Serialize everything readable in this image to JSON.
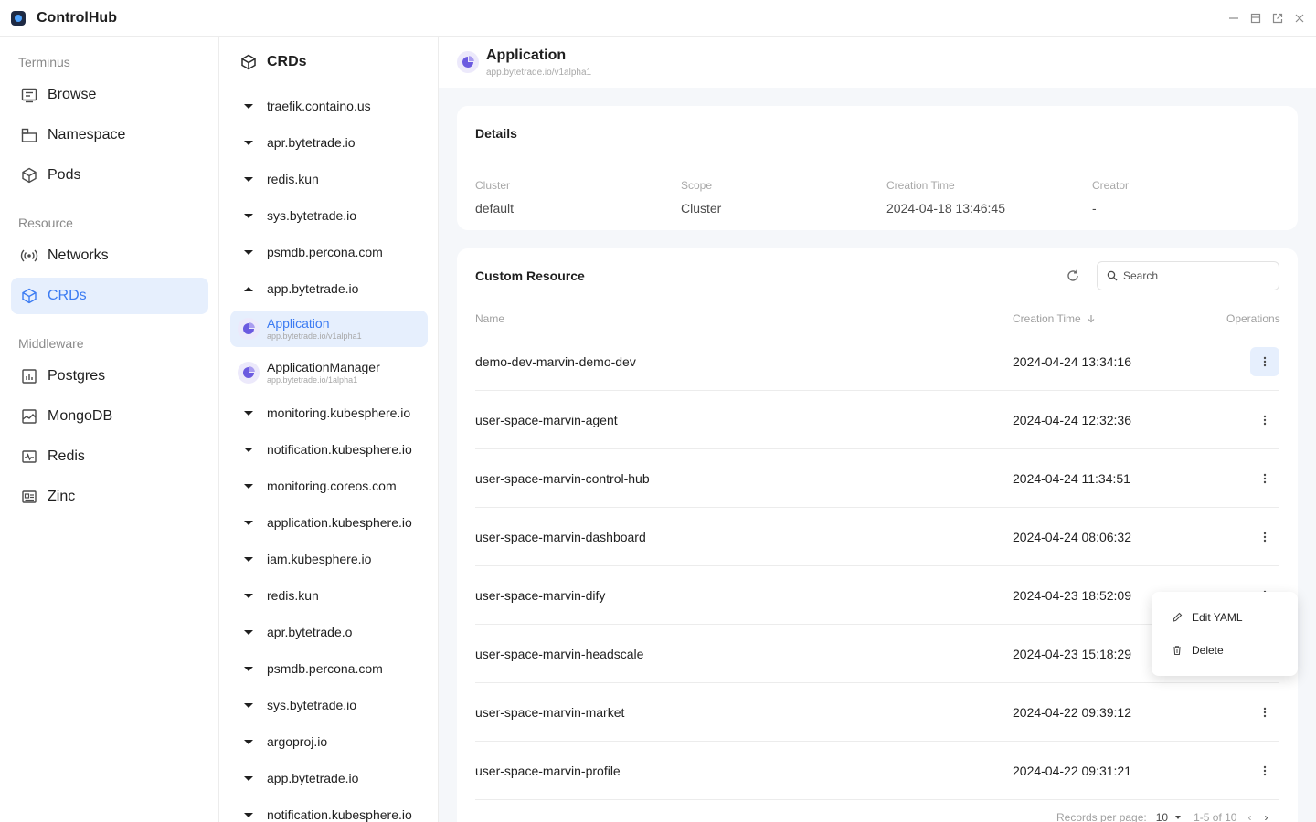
{
  "app": {
    "title": "ControlHub"
  },
  "nav": {
    "sections": [
      {
        "label": "Terminus",
        "items": [
          {
            "label": "Browse",
            "icon": "browse-icon"
          },
          {
            "label": "Namespace",
            "icon": "namespace-icon"
          },
          {
            "label": "Pods",
            "icon": "pods-icon"
          }
        ]
      },
      {
        "label": "Resource",
        "items": [
          {
            "label": "Networks",
            "icon": "networks-icon"
          },
          {
            "label": "CRDs",
            "icon": "crds-icon",
            "active": true
          }
        ]
      },
      {
        "label": "Middleware",
        "items": [
          {
            "label": "Postgres",
            "icon": "postgres-icon"
          },
          {
            "label": "MongoDB",
            "icon": "mongodb-icon"
          },
          {
            "label": "Redis",
            "icon": "redis-icon"
          },
          {
            "label": "Zinc",
            "icon": "zinc-icon"
          }
        ]
      }
    ]
  },
  "crd_list": {
    "title": "CRDs",
    "groups_before": [
      "traefik.containo.us",
      "apr.bytetrade.io",
      "redis.kun",
      "sys.bytetrade.io",
      "psmdb.percona.com"
    ],
    "expanded_group": "app.bytetrade.io",
    "expanded_items": [
      {
        "name": "Application",
        "version": "app.bytetrade.io/v1alpha1",
        "active": true
      },
      {
        "name": "ApplicationManager",
        "version": "app.bytetrade.io/1alpha1"
      }
    ],
    "groups_after": [
      "monitoring.kubesphere.io",
      "notification.kubesphere.io",
      "monitoring.coreos.com",
      "application.kubesphere.io",
      "iam.kubesphere.io",
      "redis.kun",
      "apr.bytetrade.o",
      "psmdb.percona.com",
      "sys.bytetrade.io",
      "argoproj.io",
      "app.bytetrade.io",
      "notification.kubesphere.io"
    ]
  },
  "header": {
    "title": "Application",
    "subtitle": "app.bytetrade.io/v1alpha1"
  },
  "details": {
    "title": "Details",
    "fields": [
      {
        "label": "Cluster",
        "value": "default"
      },
      {
        "label": "Scope",
        "value": "Cluster"
      },
      {
        "label": "Creation Time",
        "value": "2024-04-18 13:46:45"
      },
      {
        "label": "Creator",
        "value": "-"
      }
    ]
  },
  "resources": {
    "title": "Custom Resource",
    "search_placeholder": "Search",
    "columns": {
      "name": "Name",
      "time": "Creation Time",
      "ops": "Operations"
    },
    "rows": [
      {
        "name": "demo-dev-marvin-demo-dev",
        "time": "2024-04-24 13:34:16"
      },
      {
        "name": "user-space-marvin-agent",
        "time": "2024-04-24 12:32:36"
      },
      {
        "name": "user-space-marvin-control-hub",
        "time": "2024-04-24 11:34:51"
      },
      {
        "name": "user-space-marvin-dashboard",
        "time": "2024-04-24 08:06:32"
      },
      {
        "name": "user-space-marvin-dify",
        "time": "2024-04-23 18:52:09"
      },
      {
        "name": "user-space-marvin-headscale",
        "time": "2024-04-23 15:18:29"
      },
      {
        "name": "user-space-marvin-market",
        "time": "2024-04-22 09:39:12"
      },
      {
        "name": "user-space-marvin-profile",
        "time": "2024-04-22 09:31:21"
      }
    ],
    "menu": {
      "edit": "Edit YAML",
      "delete": "Delete"
    },
    "pagination": {
      "label": "Records per page:",
      "per_page": "10",
      "range": "1-5 of 10"
    }
  },
  "colors": {
    "accent": "#3b7bf2",
    "active_bg": "#e6effd",
    "app_icon": "#6b5ae0"
  }
}
